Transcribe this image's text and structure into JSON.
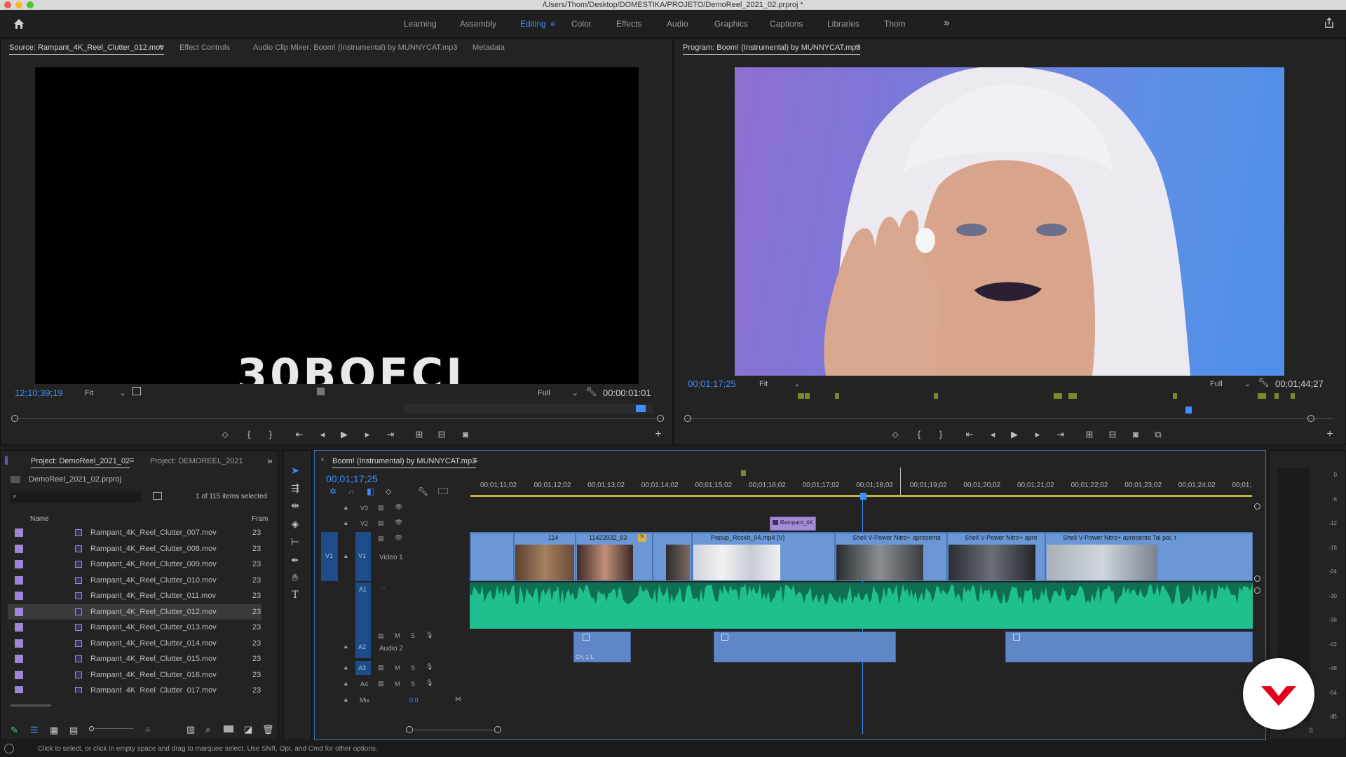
{
  "window": {
    "title": "/Users/Thom/Desktop/DOMESTIKA/PROJETO/DemoReel_2021_02.prproj *"
  },
  "workspaces": [
    {
      "label": "Learning",
      "active": false
    },
    {
      "label": "Assembly",
      "active": false
    },
    {
      "label": "Editing",
      "active": true
    },
    {
      "label": "Color",
      "active": false
    },
    {
      "label": "Effects",
      "active": false
    },
    {
      "label": "Audio",
      "active": false
    },
    {
      "label": "Graphics",
      "active": false
    },
    {
      "label": "Captions",
      "active": false
    },
    {
      "label": "Libraries",
      "active": false
    },
    {
      "label": "Thom",
      "active": false
    }
  ],
  "source_panel": {
    "tabs": [
      "Source: Rampant_4K_Reel_Clutter_012.mov",
      "Effect Controls",
      "Audio Clip Mixer: Boom! (Instrumental) by MUNNYCAT.mp3",
      "Metadata"
    ],
    "overlay_text": "30BOFCI",
    "timecode": "12;10;39;19",
    "fit": "Fit",
    "resolution": "Full",
    "duration": "00:00:01:01"
  },
  "program_panel": {
    "tab": "Program: Boom! (Instrumental) by MUNNYCAT.mp3",
    "timecode": "00;01;17;25",
    "fit": "Fit",
    "resolution": "Full",
    "duration": "00;01;44;27"
  },
  "project_panel": {
    "tabs": [
      "Project: DemoReel_2021_02",
      "Project: DEMOREEL_2021"
    ],
    "file": "DemoReel_2021_02.prproj",
    "selection_info": "1 of 115 items selected",
    "columns": {
      "name": "Name",
      "frame": "Fram"
    },
    "items": [
      {
        "name": "Rampant_4K_Reel_Clutter_007.mov",
        "fps": "23",
        "selected": false
      },
      {
        "name": "Rampant_4K_Reel_Clutter_008.mov",
        "fps": "23",
        "selected": false
      },
      {
        "name": "Rampant_4K_Reel_Clutter_009.mov",
        "fps": "23",
        "selected": false
      },
      {
        "name": "Rampant_4K_Reel_Clutter_010.mov",
        "fps": "23",
        "selected": false
      },
      {
        "name": "Rampant_4K_Reel_Clutter_011.mov",
        "fps": "23",
        "selected": false
      },
      {
        "name": "Rampant_4K_Reel_Clutter_012.mov",
        "fps": "23",
        "selected": true
      },
      {
        "name": "Rampant_4K_Reel_Clutter_013.mov",
        "fps": "23",
        "selected": false
      },
      {
        "name": "Rampant_4K_Reel_Clutter_014.mov",
        "fps": "23",
        "selected": false
      },
      {
        "name": "Rampant_4K_Reel_Clutter_015.mov",
        "fps": "23",
        "selected": false
      },
      {
        "name": "Rampant_4K_Reel_Clutter_016.mov",
        "fps": "23",
        "selected": false
      },
      {
        "name": "Rampant_4K_Reel_Clutter_017.mov",
        "fps": "23",
        "selected": false
      }
    ]
  },
  "timeline": {
    "tab": "Boom! (Instrumental) by MUNNYCAT.mp3",
    "timecode": "00;01;17;25",
    "ruler": [
      "00;01;11;02",
      "00;01;12;02",
      "00;01;13;02",
      "00;01;14;02",
      "00;01;15;02",
      "00;01;16;02",
      "00;01;17;02",
      "00;01;18;02",
      "00;01;19;02",
      "00;01;20;02",
      "00;01;21;02",
      "00;01;22;02",
      "00;01;23;02",
      "00;01;24;02",
      "00;01;"
    ],
    "tracks": {
      "v3": "V3",
      "v2": "V2",
      "v1": "V1",
      "v1_src": "V1",
      "video1": "Video 1",
      "a1": "A1",
      "a1_src": "A1",
      "a2": "A2",
      "audio2": "Audio 2",
      "a3": "A3",
      "a4": "A4",
      "mix": "Mix",
      "mix_value": "0.0",
      "m": "M",
      "s": "S"
    },
    "clips": {
      "v2_clip": "Rampant_4K",
      "v1": [
        "114",
        "11423932_83",
        "fx",
        "Popup_RockIt_04.mp4 [V]",
        "Shell V-Power Nitro+ apresenta",
        "Shell V-Power Nitro+ apre",
        "Shell V-Power Nitro+ apresenta Tal pai, t"
      ],
      "a2_label": "Ch. 1:L"
    },
    "meter_labels": [
      "0",
      "-6",
      "-12",
      "-18",
      "-24",
      "-30",
      "-36",
      "-42",
      "-48",
      "-54",
      "dB"
    ],
    "meter_solo": "S"
  },
  "status": "Click to select, or click in empty space and drag to marquee select. Use Shift, Opt, and Cmd for other options.",
  "colors": {
    "accent": "#3d8fff",
    "audio_a1": "#1fbf8f",
    "video_clip": "#6b97d6",
    "purple_clip": "#a38bd8",
    "badge": "#e3001b"
  }
}
